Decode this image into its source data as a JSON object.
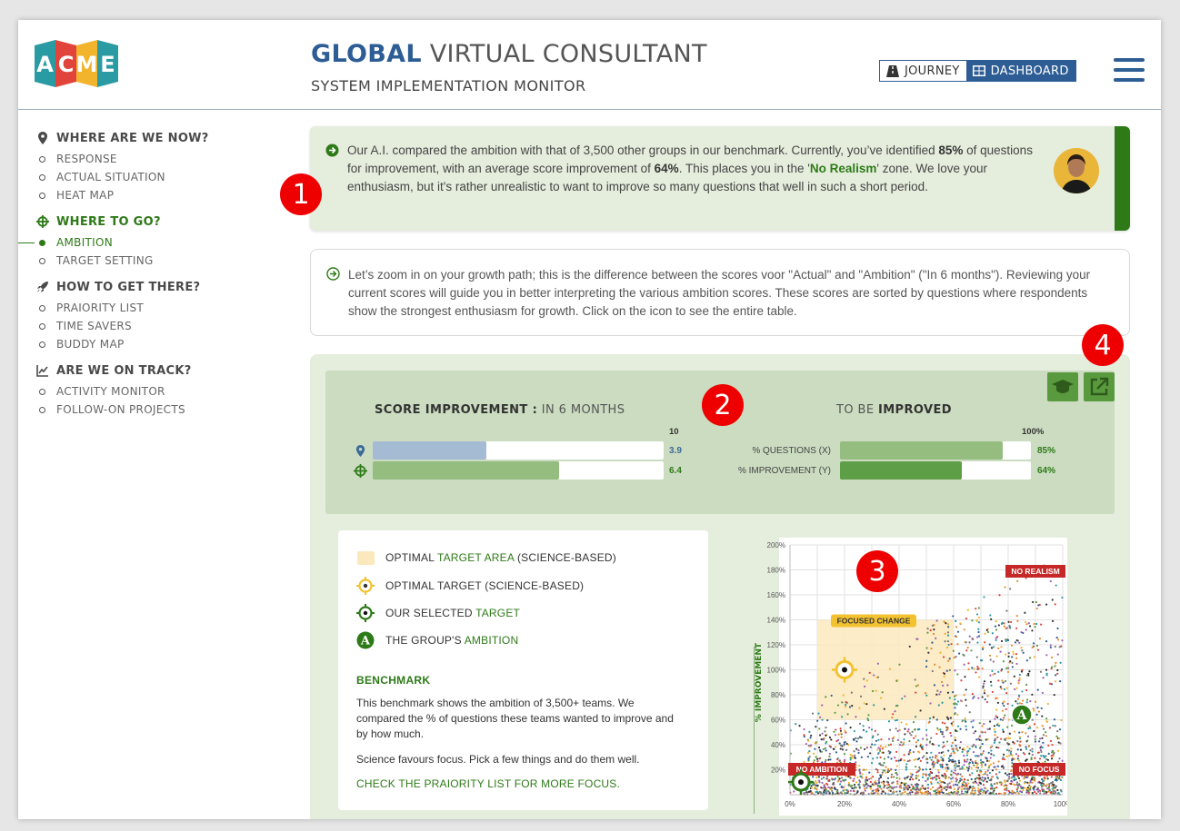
{
  "header": {
    "logo_letters": [
      "A",
      "C",
      "M",
      "E"
    ],
    "title_bold": "GLOBAL",
    "title_rest": " VIRTUAL CONSULTANT",
    "subtitle": "SYSTEM IMPLEMENTATION MONITOR",
    "toggle_journey": "JOURNEY",
    "toggle_dashboard": "DASHBOARD"
  },
  "sidebar": {
    "sections": [
      {
        "title": "WHERE ARE WE NOW?",
        "icon": "map-pin-icon",
        "items": [
          "RESPONSE",
          "ACTUAL SITUATION",
          "HEAT MAP"
        ]
      },
      {
        "title": "WHERE TO GO?",
        "icon": "crosshair-icon",
        "items": [
          "AMBITION",
          "TARGET SETTING"
        ]
      },
      {
        "title": "HOW TO GET THERE?",
        "icon": "rocket-icon",
        "items": [
          "PRAIORITY LIST",
          "TIME SAVERS",
          "BUDDY MAP"
        ]
      },
      {
        "title": "ARE WE ON TRACK?",
        "icon": "trend-chart-icon",
        "items": [
          "ACTIVITY MONITOR",
          "FOLLOW-ON PROJECTS"
        ]
      }
    ],
    "active_item": "AMBITION"
  },
  "info1": {
    "t1": "Our A.I. compared the ambition with that of 3,500 other groups in our benchmark. Currently, you’ve identified ",
    "b1": "85%",
    "t2": " of questions for improvement, with an average score improvement of ",
    "b2": "64%",
    "t3": ". This places you in the '",
    "g1": "No Realism",
    "t4": "' zone. We love your enthusiasm, but it's rather unrealistic to want to improve so many questions that well in such a short period."
  },
  "info2": {
    "text": "Let’s zoom in on your growth path; this is the difference between the scores voor \"Actual\" and \"Ambition\" (\"In 6 months\"). Reviewing your current scores will guide you in better interpreting the various ambition scores. These scores are sorted by questions where respondents show the strongest enthusiasm for growth. Click on the icon to see the entire table."
  },
  "markers": [
    "1",
    "2",
    "3",
    "4"
  ],
  "score": {
    "title_bold": "SCORE IMPROVEMENT :",
    "title_rest": " IN 6 MONTHS",
    "max_label": "10",
    "max": 10,
    "actual": 3.9,
    "actual_label": "3.9",
    "ambition": 6.4,
    "ambition_label": "6.4",
    "actual_color": "#a4bbd3",
    "ambition_color": "#94bd7f"
  },
  "improve": {
    "title_rest": "TO BE ",
    "title_bold": "IMPROVED",
    "max_label": "100%",
    "questions_label": "% QUESTIONS (X)",
    "questions_pct": 85,
    "questions_value": "85%",
    "improvement_label": "% IMPROVEMENT (Y)",
    "improvement_pct": 64,
    "improvement_value": "64%",
    "questions_color": "#94bd7f",
    "improvement_color": "#5e9e46"
  },
  "legend": {
    "row1_a": "OPTIMAL ",
    "row1_g": "TARGET AREA",
    "row1_b": " (SCIENCE-BASED)",
    "row2": "OPTIMAL TARGET (SCIENCE-BASED)",
    "row3_a": "OUR SELECTED ",
    "row3_g": "TARGET",
    "row4_a": "THE GROUP'S ",
    "row4_g": "AMBITION",
    "ambition_badge": "A",
    "bench_heading": "BENCHMARK",
    "bench_p1": "This benchmark shows the ambition of 3,500+ teams. We compared the % of questions these teams wanted to improve and by how much.",
    "bench_p2": "Science favours focus. Pick a few things and do them well.",
    "bench_link": "CHECK THE PRAIORITY LIST FOR MORE FOCUS."
  },
  "chart_data": {
    "type": "scatter",
    "ylabel": "% IMPROVEMENT",
    "xlabel": "",
    "x_ticks": [
      "0%",
      "20%",
      "40%",
      "60%",
      "80%",
      "100%"
    ],
    "y_ticks": [
      "20%",
      "40%",
      "60%",
      "80%",
      "100%",
      "120%",
      "140%",
      "160%",
      "180%",
      "200%"
    ],
    "xlim": [
      0,
      100
    ],
    "ylim": [
      0,
      200
    ],
    "zones": [
      "NO REALISM",
      "FOCUSED CHANGE",
      "NO AMBITION",
      "NO FOCUS"
    ],
    "optimal_target_area": {
      "x": [
        10,
        60
      ],
      "y": [
        60,
        140
      ]
    },
    "optimal_target": {
      "x": 20,
      "y": 100
    },
    "selected_target": {
      "x": 2,
      "y": 5
    },
    "group_ambition": {
      "x": 85,
      "y": 64,
      "badge": "A"
    },
    "benchmark_points": 3500,
    "colors": {
      "target_area": "#fbe9bd",
      "optimal": "#f3c230",
      "selected": "#2e7a18",
      "zone_label": "#c62828"
    }
  }
}
